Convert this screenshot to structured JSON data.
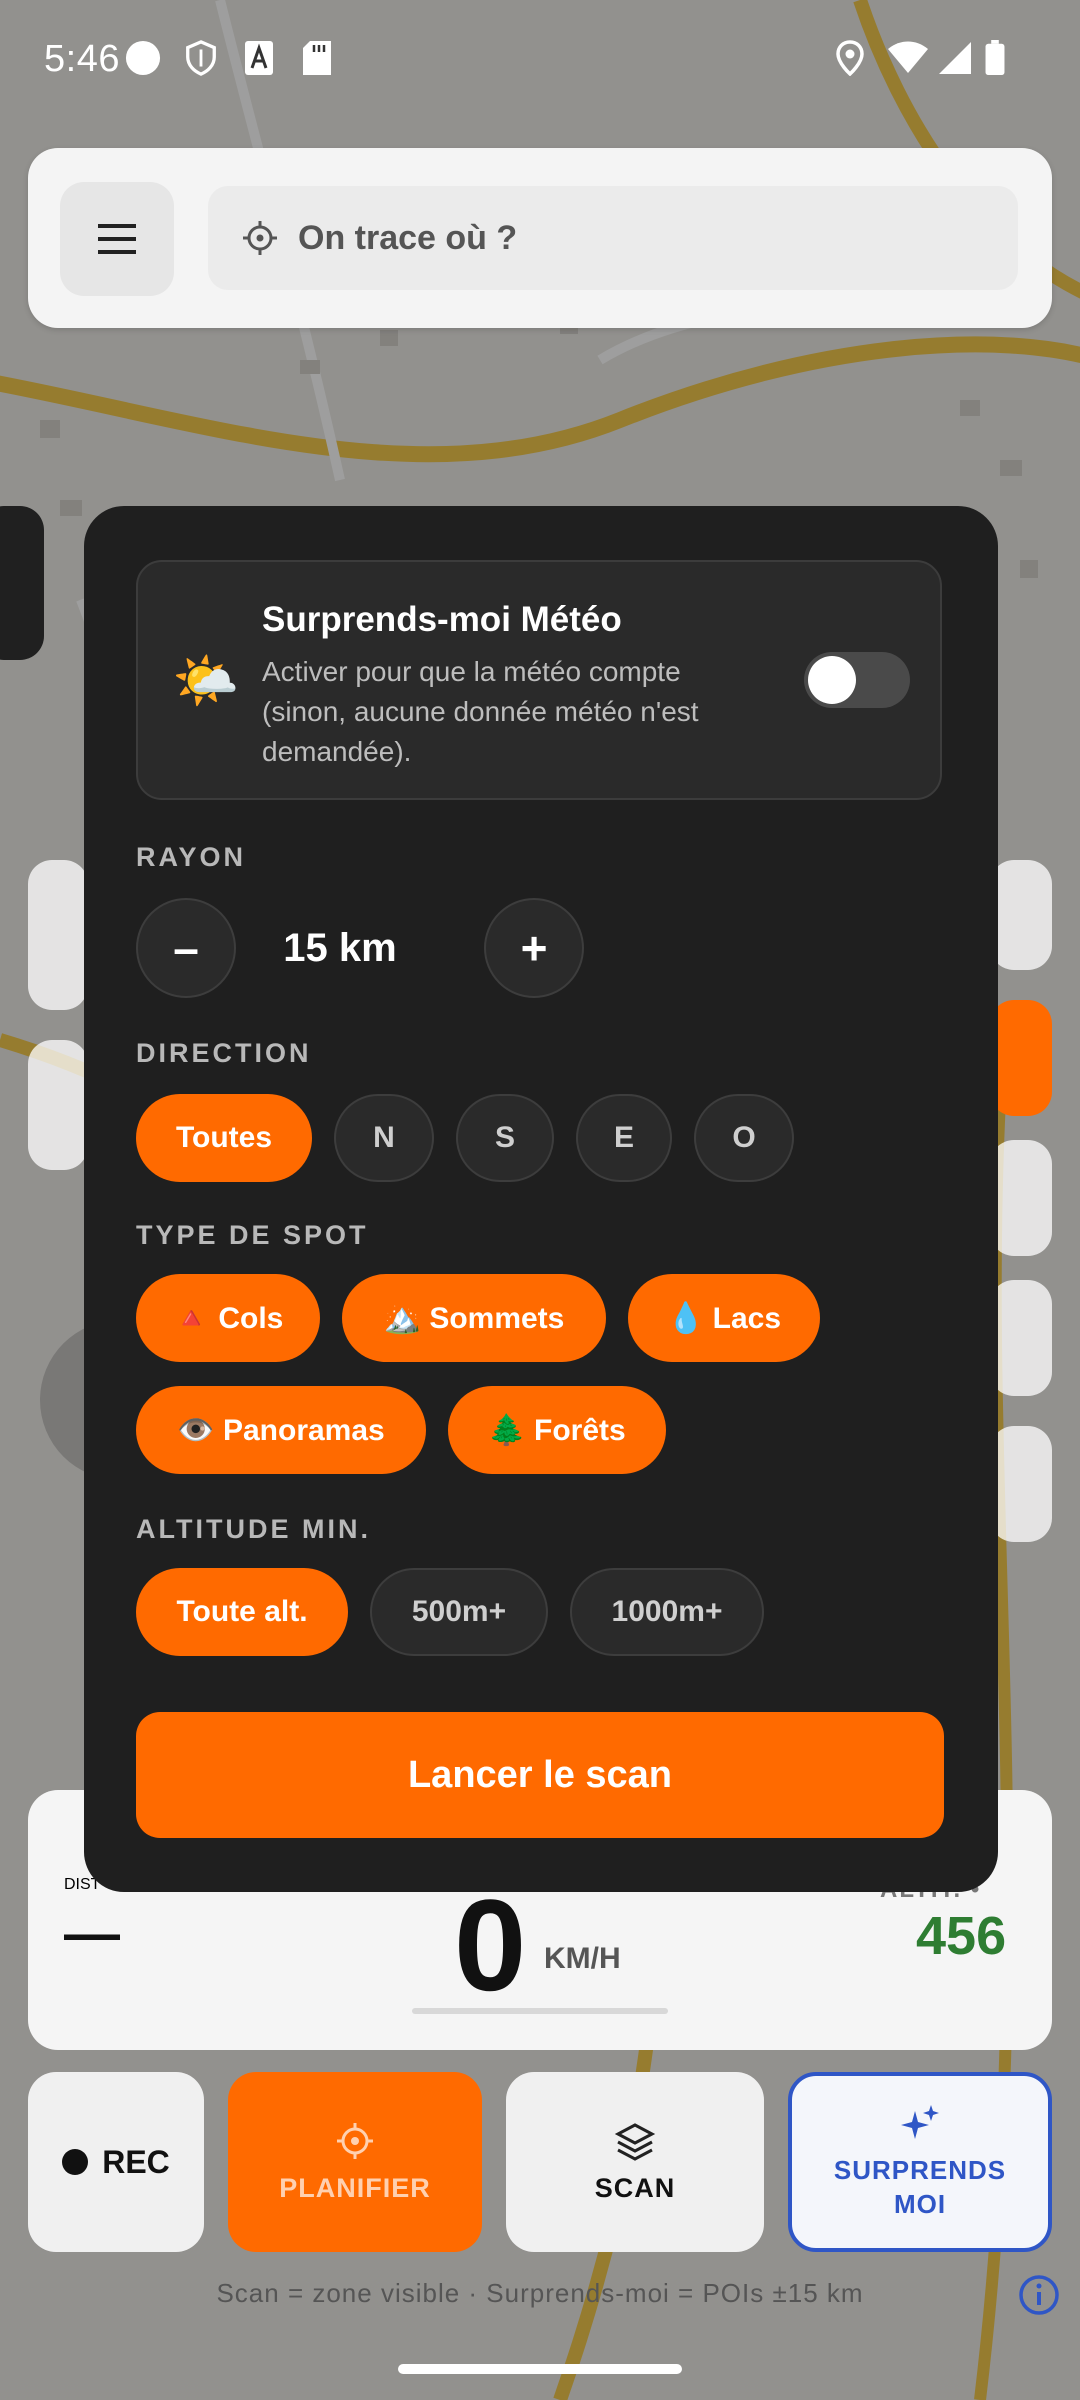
{
  "status_bar": {
    "time": "5:46"
  },
  "search": {
    "placeholder": "On trace où ?"
  },
  "stats": {
    "dist_label": "DIST",
    "dist_value": "—",
    "speed_value": "0",
    "speed_unit": "KM/H",
    "alt_label": "ALTIT. •",
    "alt_value": "456"
  },
  "bottom_bar": {
    "rec": "REC",
    "plan": "PLANIFIER",
    "scan": "SCAN",
    "surprise": "SURPRENDS\nMOI"
  },
  "hint": "Scan = zone visible · Surprends-moi = POIs ±15 km",
  "dialog": {
    "meteo": {
      "emoji": "🌤️",
      "title": "Surprends-moi Météo",
      "desc": "Activer pour que la météo compte (sinon, aucune donnée météo n'est demandée).",
      "enabled": false
    },
    "radius": {
      "label": "RAYON",
      "minus": "–",
      "value": "15 km",
      "plus": "+"
    },
    "direction": {
      "label": "DIRECTION",
      "options": [
        "Toutes",
        "N",
        "S",
        "E",
        "O"
      ],
      "selected": "Toutes"
    },
    "spot_type": {
      "label": "TYPE DE SPOT",
      "options": [
        "🔺 Cols",
        "🏔️ Sommets",
        "💧 Lacs",
        "👁️ Panoramas",
        "🌲 Forêts"
      ]
    },
    "altitude": {
      "label": "ALTITUDE MIN.",
      "options": [
        "Toute alt.",
        "500m+",
        "1000m+"
      ],
      "selected": "Toute alt."
    },
    "launch": "Lancer le scan"
  },
  "colors": {
    "accent": "#ff6a00",
    "dialog_bg": "#1f1f1f",
    "alt_green": "#2e7d32",
    "surprise_blue": "#2f56c6"
  }
}
